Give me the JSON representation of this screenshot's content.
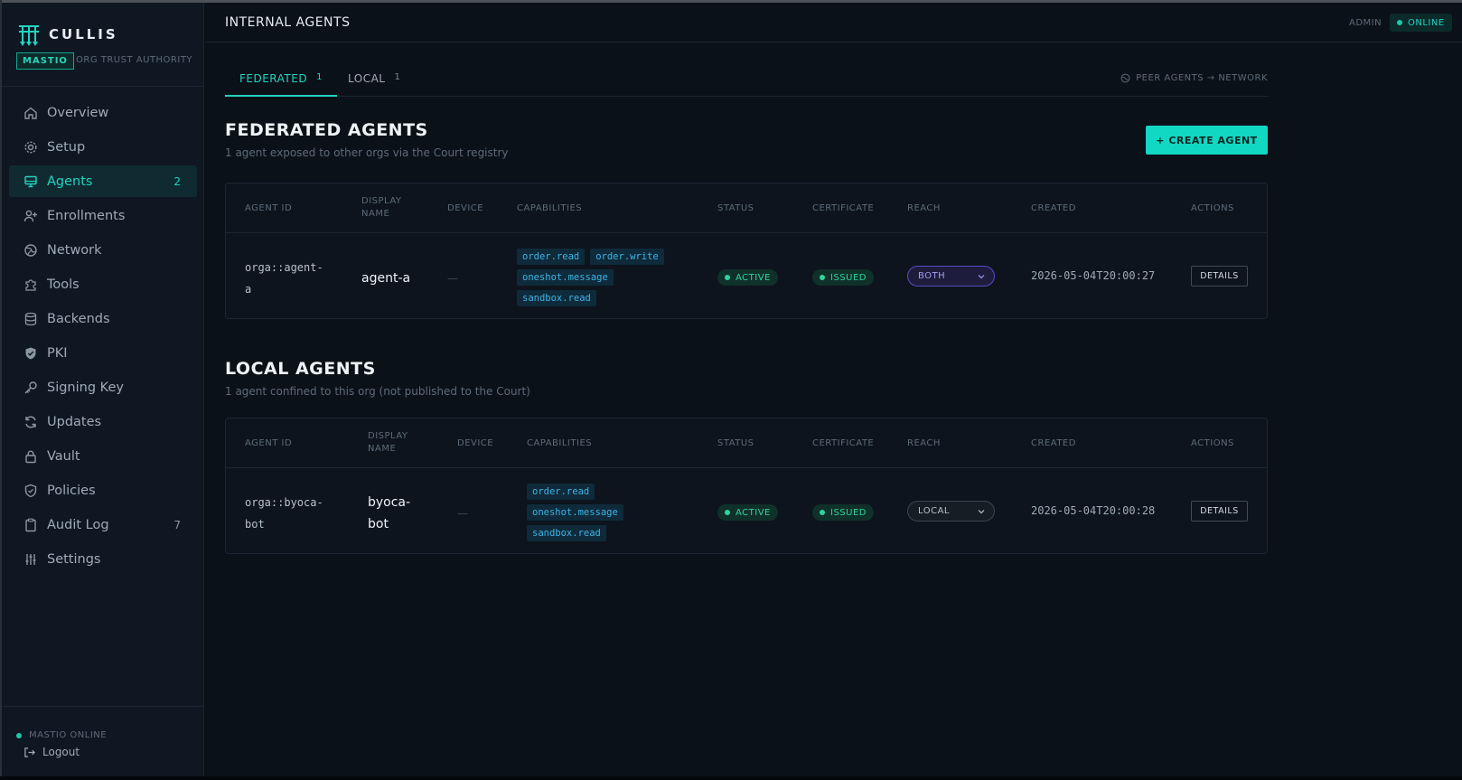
{
  "brand": {
    "name": "CULLIS",
    "badge": "MASTIO",
    "subtitle": "ORG TRUST AUTHORITY"
  },
  "sidebar": {
    "items": [
      {
        "label": "Overview",
        "icon": "home-icon",
        "count": ""
      },
      {
        "label": "Setup",
        "icon": "gear-icon",
        "count": ""
      },
      {
        "label": "Agents",
        "icon": "monitor-icon",
        "count": "2",
        "active": true
      },
      {
        "label": "Enrollments",
        "icon": "user-plus-icon",
        "count": ""
      },
      {
        "label": "Network",
        "icon": "globe-icon",
        "count": ""
      },
      {
        "label": "Tools",
        "icon": "puzzle-icon",
        "count": ""
      },
      {
        "label": "Backends",
        "icon": "database-icon",
        "count": ""
      },
      {
        "label": "PKI",
        "icon": "shield-check-icon",
        "count": ""
      },
      {
        "label": "Signing Key",
        "icon": "key-icon",
        "count": ""
      },
      {
        "label": "Updates",
        "icon": "refresh-icon",
        "count": ""
      },
      {
        "label": "Vault",
        "icon": "lock-icon",
        "count": ""
      },
      {
        "label": "Policies",
        "icon": "shield-icon",
        "count": ""
      },
      {
        "label": "Audit Log",
        "icon": "clipboard-icon",
        "count": "7"
      },
      {
        "label": "Settings",
        "icon": "sliders-icon",
        "count": ""
      }
    ],
    "status": "MASTIO ONLINE",
    "logout": "Logout"
  },
  "topbar": {
    "title": "INTERNAL AGENTS",
    "user": "ADMIN",
    "status": "ONLINE"
  },
  "tabs": [
    {
      "label": "FEDERATED",
      "count": "1",
      "active": true
    },
    {
      "label": "LOCAL",
      "count": "1"
    }
  ],
  "tabs_right_link": "PEER AGENTS → NETWORK",
  "create_button": "+ CREATE AGENT",
  "federated": {
    "title": "FEDERATED AGENTS",
    "subtitle": "1 agent exposed to other orgs via the Court registry",
    "columns": [
      "AGENT ID",
      "DISPLAY NAME",
      "DEVICE",
      "CAPABILITIES",
      "STATUS",
      "CERTIFICATE",
      "REACH",
      "CREATED",
      "ACTIONS"
    ],
    "rows": [
      {
        "agent_id_line1": "orga::agent-",
        "agent_id_line2": "a",
        "display_name_line1": "agent-a",
        "display_name_line2": "",
        "device": "—",
        "capabilities": [
          "order.read",
          "order.write",
          "oneshot.message",
          "sandbox.read"
        ],
        "status": "ACTIVE",
        "certificate": "ISSUED",
        "reach": "BOTH",
        "created": "2026-05-04T20:00:27",
        "action": "DETAILS"
      }
    ]
  },
  "local": {
    "title": "LOCAL AGENTS",
    "subtitle": "1 agent confined to this org (not published to the Court)",
    "columns": [
      "AGENT ID",
      "DISPLAY NAME",
      "DEVICE",
      "CAPABILITIES",
      "STATUS",
      "CERTIFICATE",
      "REACH",
      "CREATED",
      "ACTIONS"
    ],
    "rows": [
      {
        "agent_id_line1": "orga::byoca-",
        "agent_id_line2": "bot",
        "display_name_line1": "byoca-",
        "display_name_line2": "bot",
        "device": "—",
        "capabilities": [
          "order.read",
          "oneshot.message",
          "sandbox.read"
        ],
        "status": "ACTIVE",
        "certificate": "ISSUED",
        "reach": "LOCAL",
        "created": "2026-05-04T20:00:28",
        "action": "DETAILS"
      }
    ]
  },
  "colors": {
    "accent": "#22d3c0",
    "background": "#0b1119",
    "sidebar": "#0f1722",
    "reach_both": "#a89cf2",
    "status_ok": "#2fd49a"
  }
}
